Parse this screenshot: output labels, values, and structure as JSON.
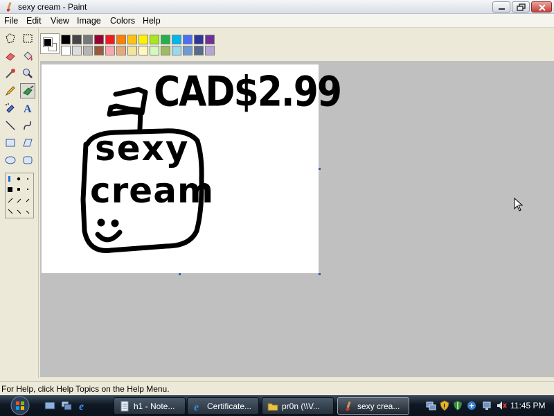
{
  "window": {
    "title": "sexy cream - Paint"
  },
  "menu": {
    "items": [
      "File",
      "Edit",
      "View",
      "Image",
      "Colors",
      "Help"
    ]
  },
  "tools": [
    {
      "name": "free-form-select-icon"
    },
    {
      "name": "rect-select-icon"
    },
    {
      "name": "eraser-icon"
    },
    {
      "name": "fill-bucket-icon"
    },
    {
      "name": "color-picker-icon"
    },
    {
      "name": "magnifier-icon"
    },
    {
      "name": "pencil-icon"
    },
    {
      "name": "brush-icon"
    },
    {
      "name": "airbrush-icon"
    },
    {
      "name": "text-icon"
    },
    {
      "name": "line-icon"
    },
    {
      "name": "curve-icon"
    },
    {
      "name": "rectangle-icon"
    },
    {
      "name": "polygon-icon"
    },
    {
      "name": "ellipse-icon"
    },
    {
      "name": "rounded-rect-icon"
    }
  ],
  "palette": {
    "foreground": "#000000",
    "background": "#ffffff",
    "row1": [
      "#000000",
      "#464646",
      "#787878",
      "#990030",
      "#ed1c24",
      "#ff7e00",
      "#ffc20e",
      "#fff200",
      "#a8e61d",
      "#22b14c",
      "#00b7ef",
      "#4d6df3",
      "#2f3699",
      "#6f3198"
    ],
    "row2": [
      "#ffffff",
      "#dcdcdc",
      "#b4b4b4",
      "#9c5a3c",
      "#ffa3b1",
      "#e5aa7a",
      "#f5e49c",
      "#fff9bd",
      "#d3f9bc",
      "#9dbb61",
      "#99d9ea",
      "#709ad1",
      "#546d8e",
      "#b5a5d5"
    ]
  },
  "canvas": {
    "drawing_text": [
      "CAD$2.99",
      "sexy",
      "cream"
    ]
  },
  "status": {
    "text": "For Help, click Help Topics on the Help Menu."
  },
  "taskbar": {
    "buttons": [
      {
        "label": "h1 - Note...",
        "icon": "notepad-icon",
        "active": false
      },
      {
        "label": "Certificate...",
        "icon": "ie-icon",
        "active": false
      },
      {
        "label": "pr0n (\\\\V...",
        "icon": "folder-icon",
        "active": false
      },
      {
        "label": "sexy crea...",
        "icon": "paint-icon",
        "active": true
      }
    ],
    "clock": "11:45 PM"
  }
}
